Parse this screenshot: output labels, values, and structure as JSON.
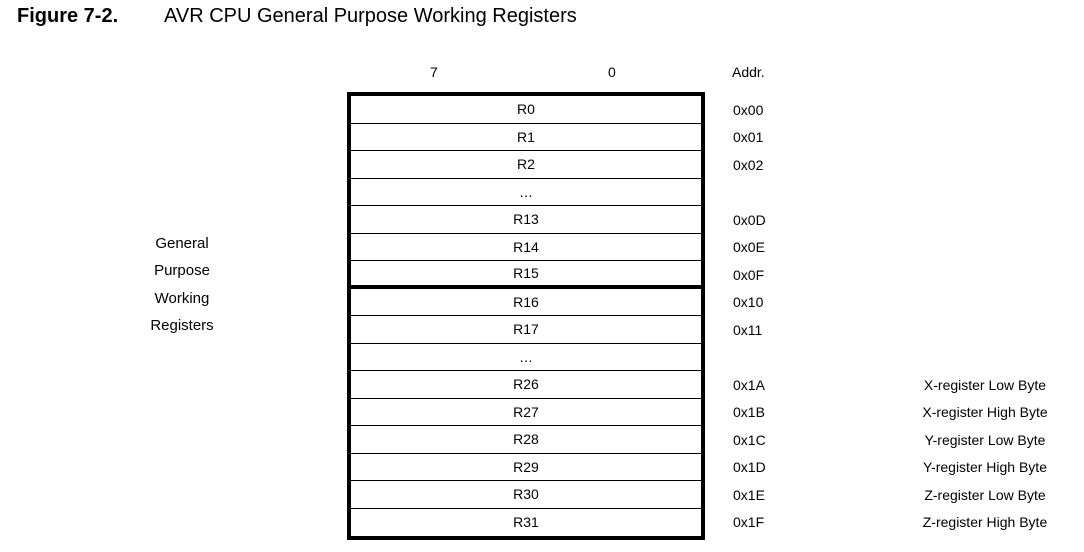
{
  "figure": {
    "label": "Figure 7-2.",
    "title": "AVR CPU General Purpose Working Registers"
  },
  "header": {
    "bit_msb": "7",
    "bit_lsb": "0",
    "addr": "Addr."
  },
  "side_label": [
    "General",
    "Purpose",
    "Working",
    "Registers"
  ],
  "rows": [
    {
      "name": "R0",
      "addr": "0x00",
      "note": ""
    },
    {
      "name": "R1",
      "addr": "0x01",
      "note": ""
    },
    {
      "name": "R2",
      "addr": "0x02",
      "note": ""
    },
    {
      "name": "…",
      "addr": "",
      "note": ""
    },
    {
      "name": "R13",
      "addr": "0x0D",
      "note": ""
    },
    {
      "name": "R14",
      "addr": "0x0E",
      "note": ""
    },
    {
      "name": "R15",
      "addr": "0x0F",
      "note": ""
    },
    {
      "name": "R16",
      "addr": "0x10",
      "note": ""
    },
    {
      "name": "R17",
      "addr": "0x11",
      "note": ""
    },
    {
      "name": "…",
      "addr": "",
      "note": ""
    },
    {
      "name": "R26",
      "addr": "0x1A",
      "note": "X-register Low Byte"
    },
    {
      "name": "R27",
      "addr": "0x1B",
      "note": "X-register High Byte"
    },
    {
      "name": "R28",
      "addr": "0x1C",
      "note": "Y-register Low Byte"
    },
    {
      "name": "R29",
      "addr": "0x1D",
      "note": "Y-register High Byte"
    },
    {
      "name": "R30",
      "addr": "0x1E",
      "note": "Z-register Low Byte"
    },
    {
      "name": "R31",
      "addr": "0x1F",
      "note": "Z-register High Byte"
    }
  ]
}
